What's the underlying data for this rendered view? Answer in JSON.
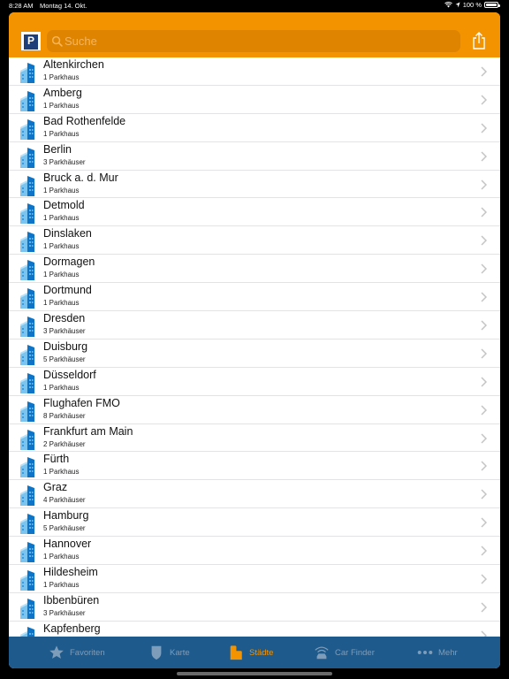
{
  "status_bar": {
    "time": "8:28 AM",
    "date": "Montag 14. Okt.",
    "battery_text": "100 %",
    "battery_level": 1.0
  },
  "header": {
    "logo_letter": "P",
    "search_placeholder": "Suche",
    "accent_color": "#F39300",
    "logo_color": "#1F3F7A"
  },
  "cities": [
    {
      "name": "Altenkirchen",
      "count": "1 Parkhaus"
    },
    {
      "name": "Amberg",
      "count": "1 Parkhaus"
    },
    {
      "name": "Bad Rothenfelde",
      "count": "1 Parkhaus"
    },
    {
      "name": "Berlin",
      "count": "3 Parkhäuser"
    },
    {
      "name": "Bruck a. d. Mur",
      "count": "1 Parkhaus"
    },
    {
      "name": "Detmold",
      "count": "1 Parkhaus"
    },
    {
      "name": "Dinslaken",
      "count": "1 Parkhaus"
    },
    {
      "name": "Dormagen",
      "count": "1 Parkhaus"
    },
    {
      "name": "Dortmund",
      "count": "1 Parkhaus"
    },
    {
      "name": "Dresden",
      "count": "3 Parkhäuser"
    },
    {
      "name": "Duisburg",
      "count": "5 Parkhäuser"
    },
    {
      "name": "Düsseldorf",
      "count": "1 Parkhaus"
    },
    {
      "name": "Flughafen FMO",
      "count": "8 Parkhäuser"
    },
    {
      "name": "Frankfurt am Main",
      "count": "2 Parkhäuser"
    },
    {
      "name": "Fürth",
      "count": "1 Parkhaus"
    },
    {
      "name": "Graz",
      "count": "4 Parkhäuser"
    },
    {
      "name": "Hamburg",
      "count": "5 Parkhäuser"
    },
    {
      "name": "Hannover",
      "count": "1 Parkhaus"
    },
    {
      "name": "Hildesheim",
      "count": "1 Parkhaus"
    },
    {
      "name": "Ibbenbüren",
      "count": "3 Parkhäuser"
    },
    {
      "name": "Kapfenberg",
      "count": ""
    }
  ],
  "icons": {
    "city": "building-icon",
    "row_chevron": "chevron-right-icon",
    "search": "search-icon",
    "share": "share-icon"
  },
  "tabs": [
    {
      "label": "Favoriten",
      "icon": "star-icon",
      "active": false
    },
    {
      "label": "Karte",
      "icon": "shield-icon",
      "active": false
    },
    {
      "label": "Städte",
      "icon": "city-icon",
      "active": true
    },
    {
      "label": "Car Finder",
      "icon": "car-finder-icon",
      "active": false
    },
    {
      "label": "Mehr",
      "icon": "more-dots-icon",
      "active": false
    }
  ],
  "colors": {
    "tabbar_bg": "#1E5A8C",
    "tab_inactive": "#7E9DBA",
    "tab_active": "#F39300"
  }
}
